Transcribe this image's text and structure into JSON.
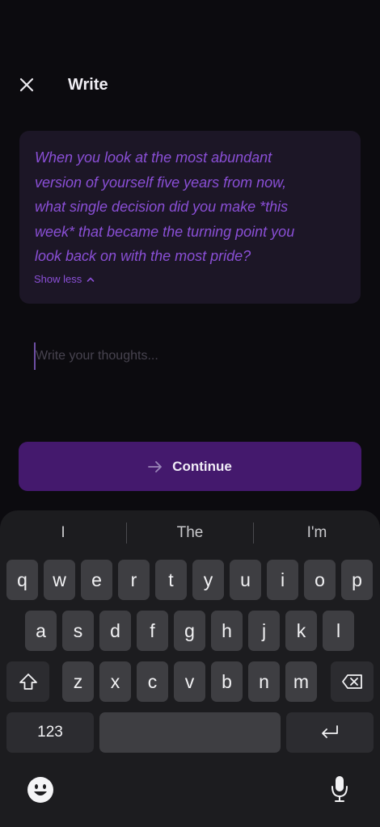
{
  "header": {
    "title": "Write"
  },
  "prompt": {
    "lines": [
      "When you look at the most abundant",
      "version of yourself five years from now,",
      "what single decision did you make *this",
      "week* that became the turning point you",
      "look back on with the most pride?"
    ],
    "toggle_label": "Show less"
  },
  "input": {
    "placeholder": "Write your thoughts..."
  },
  "continue_button": {
    "label": "Continue"
  },
  "keyboard": {
    "suggestions": [
      "I",
      "The",
      "I'm"
    ],
    "row1": [
      "q",
      "w",
      "e",
      "r",
      "t",
      "y",
      "u",
      "i",
      "o",
      "p"
    ],
    "row2": [
      "a",
      "s",
      "d",
      "f",
      "g",
      "h",
      "j",
      "k",
      "l"
    ],
    "row3": [
      "z",
      "x",
      "c",
      "v",
      "b",
      "n",
      "m"
    ],
    "numbers_label": "123"
  },
  "colors": {
    "accent": "#8a4fd6",
    "button": "#44196d",
    "card": "#1c1626"
  }
}
